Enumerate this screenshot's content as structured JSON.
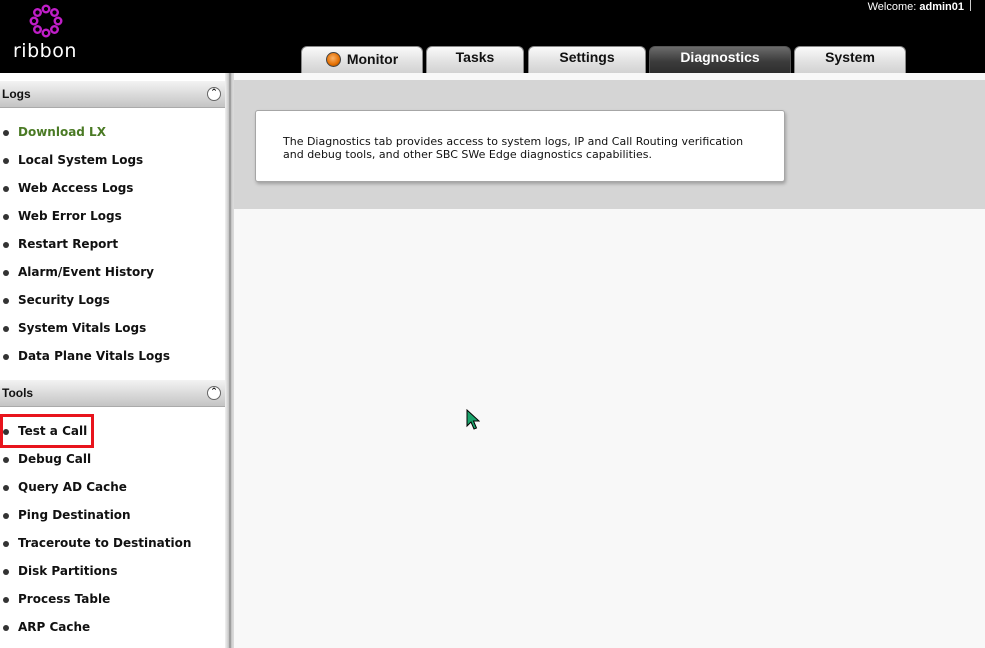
{
  "header": {
    "brand": "ribbon",
    "welcome_label": "Welcome:",
    "username": "admin01"
  },
  "tabs": [
    {
      "label": "Monitor",
      "active": false
    },
    {
      "label": "Tasks",
      "active": false
    },
    {
      "label": "Settings",
      "active": false
    },
    {
      "label": "Diagnostics",
      "active": true
    },
    {
      "label": "System",
      "active": false
    }
  ],
  "sidebar": {
    "logs_section": {
      "title": "Logs",
      "items": [
        {
          "label": "Download LX"
        },
        {
          "label": "Local System Logs"
        },
        {
          "label": "Web Access Logs"
        },
        {
          "label": "Web Error Logs"
        },
        {
          "label": "Restart Report"
        },
        {
          "label": "Alarm/Event History"
        },
        {
          "label": "Security Logs"
        },
        {
          "label": "System Vitals Logs"
        },
        {
          "label": "Data Plane Vitals Logs"
        }
      ]
    },
    "tools_section": {
      "title": "Tools",
      "items": [
        {
          "label": "Test a Call"
        },
        {
          "label": "Debug Call"
        },
        {
          "label": "Query AD Cache"
        },
        {
          "label": "Ping Destination"
        },
        {
          "label": "Traceroute to Destination"
        },
        {
          "label": "Disk Partitions"
        },
        {
          "label": "Process Table"
        },
        {
          "label": "ARP Cache"
        }
      ]
    }
  },
  "main": {
    "description": "The Diagnostics tab provides access to system logs, IP and Call Routing verification and debug tools, and other SBC SWe Edge diagnostics capabilities."
  },
  "colors": {
    "header_bg": "#000000",
    "logo_accent": "#c01ec8",
    "download_link": "#4a7a24",
    "highlight_box": "#e8141c",
    "main_band": "#d5d5d5"
  }
}
